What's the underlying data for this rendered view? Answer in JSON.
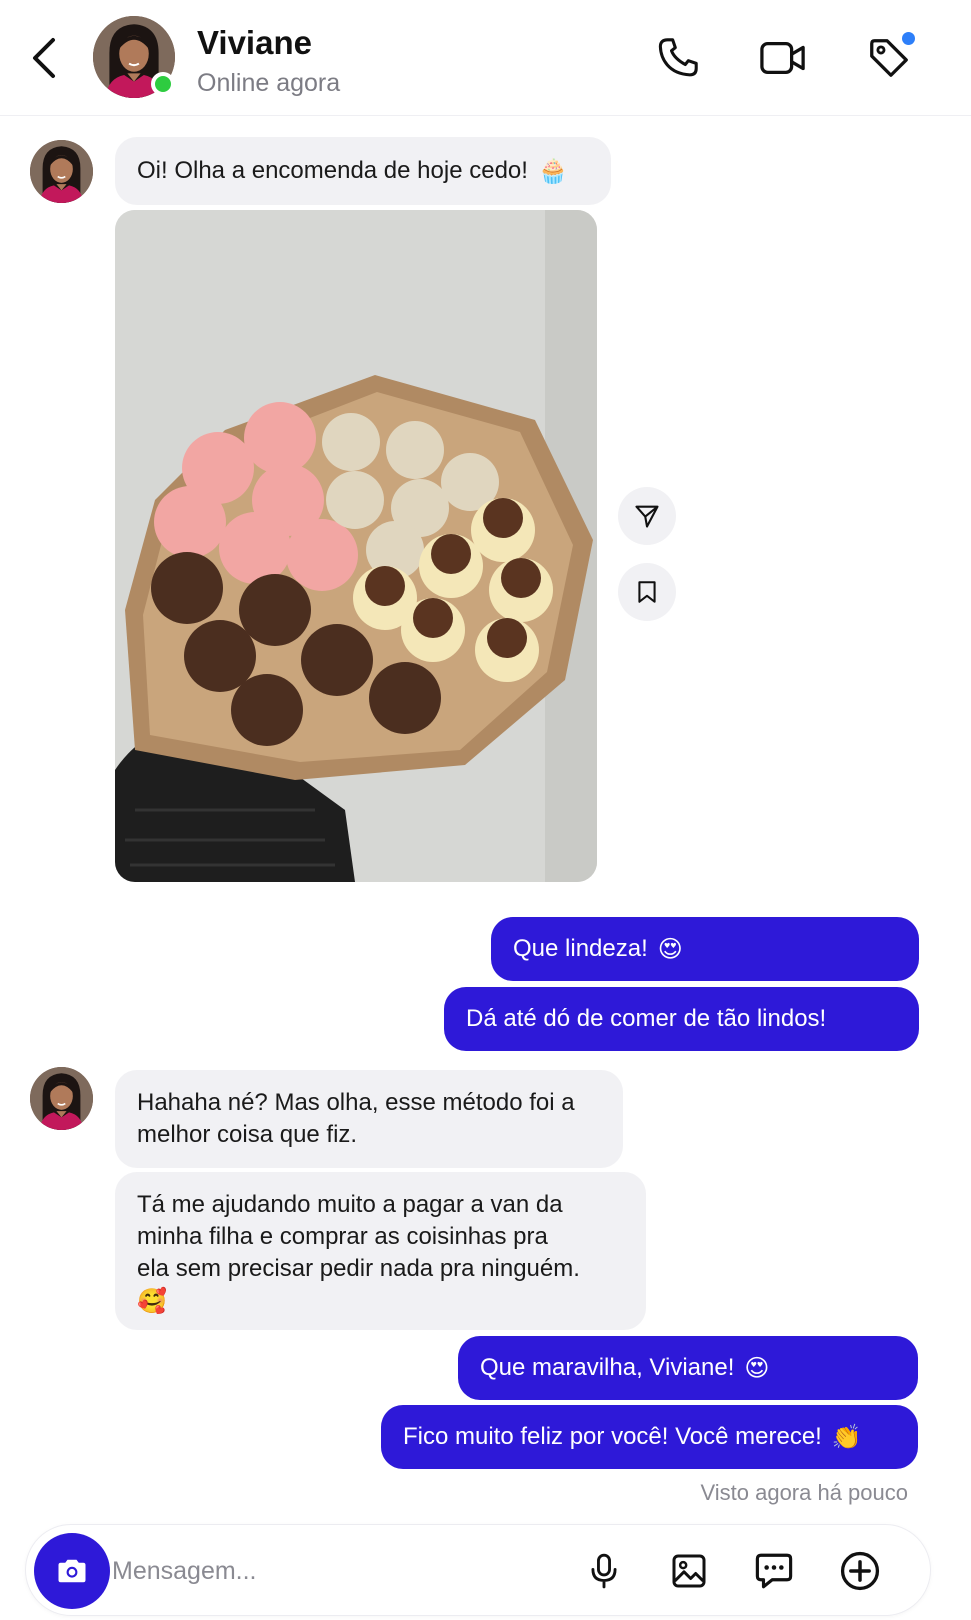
{
  "header": {
    "contact_name": "Viviane",
    "status": "Online agora",
    "icons": [
      "chevron-left-icon",
      "phone-icon",
      "video-icon",
      "tag-icon"
    ]
  },
  "messages": {
    "m1": "Oi! Olha a encomenda de hoje cedo!",
    "m1_emoji": "🧁",
    "m2": "Que lindeza!",
    "m2_emoji": "😍",
    "m3": "Dá até dó de comer de tão lindos!",
    "m4_line1": "Hahaha né? Mas olha, esse método foi a",
    "m4_line2": "melhor coisa que fiz.",
    "m5_line1": "Tá me ajudando muito a pagar a van da",
    "m5_line2": "minha filha e comprar as coisinhas pra",
    "m5_line3": "ela sem precisar pedir nada pra ninguém.",
    "m5_emoji": "🥰",
    "m6": "Que maravilha, Viviane!",
    "m6_emoji": "😍",
    "m7": "Fico muito feliz por você! Você merece!",
    "m7_emoji": "👏"
  },
  "seen_text": "Visto agora há pouco",
  "composer": {
    "placeholder": "Mensagem...",
    "icons": [
      "camera-icon",
      "microphone-icon",
      "image-icon",
      "chat-dots-icon",
      "plus-circle-icon"
    ]
  },
  "colors": {
    "accent": "#2e19d8",
    "incoming_bubble": "#f1f1f4",
    "online": "#2ecc40",
    "notification_dot": "#2d7ff9"
  }
}
